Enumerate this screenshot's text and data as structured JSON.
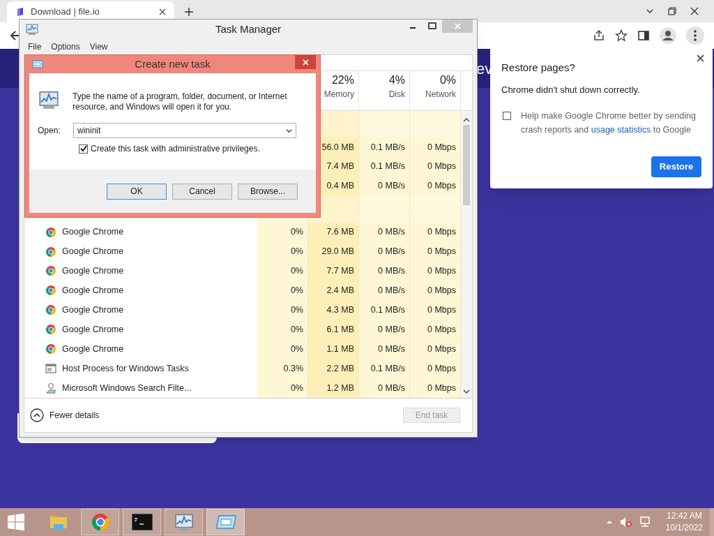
{
  "browser": {
    "tab": {
      "title": "Download | file.io"
    },
    "page_text": "ev"
  },
  "task_manager": {
    "title": "Task Manager",
    "menu": [
      "File",
      "Options",
      "View"
    ],
    "columns": [
      {
        "percent": "22%",
        "label": "Memory"
      },
      {
        "percent": "4%",
        "label": "Disk"
      },
      {
        "percent": "0%",
        "label": "Network"
      }
    ],
    "rows": [
      {
        "kind": "group"
      },
      {
        "kind": "hidden",
        "memory": "56.0 MB",
        "disk": "0.1 MB/s",
        "network": "0 Mbps"
      },
      {
        "kind": "hidden",
        "memory": "7.4 MB",
        "disk": "0.1 MB/s",
        "network": "0 Mbps"
      },
      {
        "kind": "hidden",
        "memory": "0.4 MB",
        "disk": "0 MB/s",
        "network": "0 Mbps"
      },
      {
        "kind": "group"
      },
      {
        "kind": "chrome",
        "name": "Google Chrome",
        "cpu": "0%",
        "memory": "7.6 MB",
        "disk": "0 MB/s",
        "network": "0 Mbps"
      },
      {
        "kind": "chrome",
        "name": "Google Chrome",
        "cpu": "0%",
        "memory": "29.0 MB",
        "disk": "0 MB/s",
        "network": "0 Mbps"
      },
      {
        "kind": "chrome",
        "name": "Google Chrome",
        "cpu": "0%",
        "memory": "7.7 MB",
        "disk": "0 MB/s",
        "network": "0 Mbps"
      },
      {
        "kind": "chrome",
        "name": "Google Chrome",
        "cpu": "0%",
        "memory": "2.4 MB",
        "disk": "0 MB/s",
        "network": "0 Mbps"
      },
      {
        "kind": "chrome",
        "name": "Google Chrome",
        "cpu": "0%",
        "memory": "4.3 MB",
        "disk": "0.1 MB/s",
        "network": "0 Mbps"
      },
      {
        "kind": "chrome",
        "name": "Google Chrome",
        "cpu": "0%",
        "memory": "6.1 MB",
        "disk": "0 MB/s",
        "network": "0 Mbps"
      },
      {
        "kind": "chrome",
        "name": "Google Chrome",
        "cpu": "0%",
        "memory": "1.1 MB",
        "disk": "0 MB/s",
        "network": "0 Mbps"
      },
      {
        "kind": "host",
        "name": "Host Process for Windows Tasks",
        "cpu": "0.3%",
        "memory": "2.2 MB",
        "disk": "0.1 MB/s",
        "network": "0 Mbps"
      },
      {
        "kind": "search",
        "name": "Microsoft Windows Search Filte...",
        "cpu": "0%",
        "memory": "1.2 MB",
        "disk": "0 MB/s",
        "network": "0 Mbps"
      }
    ],
    "footer": {
      "toggle": "Fewer details",
      "end_task": {
        "label": "End task",
        "disabled": true
      }
    }
  },
  "dialog": {
    "title": "Create new task",
    "message": "Type the name of a program, folder, document, or Internet resource, and Windows will open it for you.",
    "open_label": "Open:",
    "open_value": "wininit",
    "admin": {
      "label": "Create this task with administrative privileges.",
      "checked": true
    },
    "buttons": [
      {
        "label": "OK",
        "default": true
      },
      {
        "label": "Cancel",
        "default": false
      },
      {
        "label": "Browse...",
        "default": false
      }
    ]
  },
  "restore_popup": {
    "title": "Restore pages?",
    "message": "Chrome didn't shut down correctly.",
    "consent": {
      "checked": false,
      "text_before": "Help make Google Chrome better by sending crash reports and",
      "link": "usage statistics",
      "text_after": "to Google"
    },
    "button": "Restore"
  },
  "taskbar": {
    "apps": [
      {
        "kind": "explorer",
        "running": false,
        "selected": false
      },
      {
        "kind": "chrome",
        "running": true,
        "selected": false
      },
      {
        "kind": "cmd",
        "running": true,
        "selected": false
      },
      {
        "kind": "taskmgr",
        "running": true,
        "selected": false
      },
      {
        "kind": "run",
        "running": true,
        "selected": true
      }
    ],
    "clock": {
      "time": "12:42 AM",
      "date": "10/1/2022"
    }
  }
}
